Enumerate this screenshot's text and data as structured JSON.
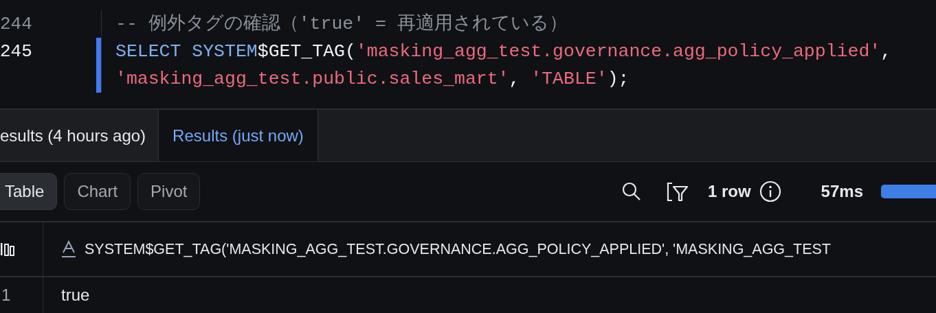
{
  "editor": {
    "lines": [
      {
        "number": "244",
        "current": false,
        "segments": [
          {
            "tokens": [
              {
                "kind": "comment",
                "text": "-- 例外タグの確認（'true' = 再適用されている）"
              }
            ]
          }
        ]
      },
      {
        "number": "245",
        "current": true,
        "segments": [
          {
            "tokens": [
              {
                "kind": "keyword",
                "text": "SELECT SYSTEM"
              },
              {
                "kind": "plain",
                "text": "$GET_TAG("
              },
              {
                "kind": "string",
                "text": "'masking_agg_test.governance.agg_policy_applied'"
              },
              {
                "kind": "plain",
                "text": ","
              }
            ]
          },
          {
            "tokens": [
              {
                "kind": "string",
                "text": "'masking_agg_test.public.sales_mart'"
              },
              {
                "kind": "plain",
                "text": ", "
              },
              {
                "kind": "string",
                "text": "'TABLE'"
              },
              {
                "kind": "plain",
                "text": ");"
              }
            ]
          }
        ]
      }
    ]
  },
  "result_tabs": [
    {
      "label": "esults (4 hours ago)",
      "selected": false
    },
    {
      "label": "Results (just now)",
      "selected": true
    }
  ],
  "view_buttons": [
    {
      "label": "Table",
      "selected": true
    },
    {
      "label": "Chart",
      "selected": false
    },
    {
      "label": "Pivot",
      "selected": false
    }
  ],
  "toolbar": {
    "row_count": "1 row",
    "duration": "57ms",
    "progress": {
      "level": 1
    }
  },
  "table": {
    "columns": [
      {
        "header": "SYSTEM$GET_TAG('MASKING_AGG_TEST.GOVERNANCE.AGG_POLICY_APPLIED', 'MASKING_AGG_TEST",
        "kind": "text"
      }
    ],
    "rows": [
      {
        "number": "1",
        "cells": [
          "true"
        ]
      }
    ]
  }
}
